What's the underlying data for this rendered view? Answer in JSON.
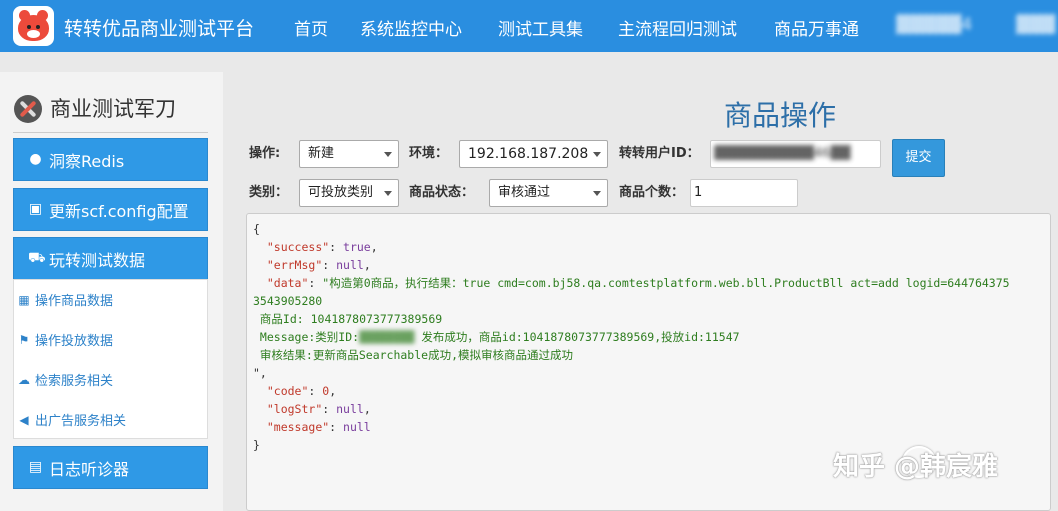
{
  "brand": "转转优品商业测试平台",
  "nav": [
    {
      "label": "首页"
    },
    {
      "label": "系统监控中心"
    },
    {
      "label": "测试工具集"
    },
    {
      "label": "主流程回归测试"
    },
    {
      "label": "商品万事通"
    },
    {
      "label": "▓▓▓▓▓4"
    },
    {
      "label": "▓▓▓"
    }
  ],
  "sidebar": {
    "title": "商业测试军刀",
    "buttons": [
      {
        "label": "洞察Redis",
        "icon": "globe-icon"
      },
      {
        "label": "更新scf.config配置",
        "icon": "config-icon"
      },
      {
        "label": "玩转测试数据",
        "icon": "cart-icon"
      }
    ],
    "sub_items": [
      {
        "label": "操作商品数据",
        "icon": "gift-icon"
      },
      {
        "label": "操作投放数据",
        "icon": "flag-icon"
      },
      {
        "label": "检索服务相关",
        "icon": "cloud-icon"
      },
      {
        "label": "出广告服务相关",
        "icon": "megaphone-icon"
      }
    ],
    "bottom_button": {
      "label": "日志听诊器",
      "icon": "briefcase-icon"
    }
  },
  "main": {
    "title": "商品操作",
    "form": {
      "op_label": "操作:",
      "op_value": "新建",
      "env_label": "环境：",
      "env_value": "192.168.187.208",
      "uid_label": "转转用户ID：",
      "uid_value": "▓▓▓▓▓▓▓▓▓▓46▓▓",
      "submit": "提交",
      "cat_label": "类别：",
      "cat_value": "可投放类别",
      "status_label": "商品状态：",
      "status_value": "审核通过",
      "count_label": "商品个数：",
      "count_value": "1"
    },
    "result": {
      "open": "{",
      "success_key": "\"success\"",
      "success_val": "true",
      "errmsg_key": "\"errMsg\"",
      "errmsg_val": "null",
      "data_key": "\"data\"",
      "data_val_1": "\"构造第0商品，执行结果：true cmd=com.bj58.qa.comtestplatform.web.bll.ProductBll act=add logid=644764375",
      "data_val_2": "3543905280",
      "data_val_3": " 商品Id: 1041878073777389569",
      "data_val_4_prefix": " Message:类别ID:",
      "data_val_4_blur": "▓▓▓▓▓▓▓▓",
      "data_val_4_suffix": " 发布成功，商品id:1041878073777389569,投放id:11547",
      "data_val_5": " 审核结果:更新商品Searchable成功,模拟审核商品通过成功",
      "data_end": "\",",
      "code_key": "\"code\"",
      "code_val": "0",
      "logstr_key": "\"logStr\"",
      "logstr_val": "null",
      "message_key": "\"message\"",
      "message_val": "null",
      "close": "}"
    }
  },
  "watermark": "知乎 @韩宸雅"
}
